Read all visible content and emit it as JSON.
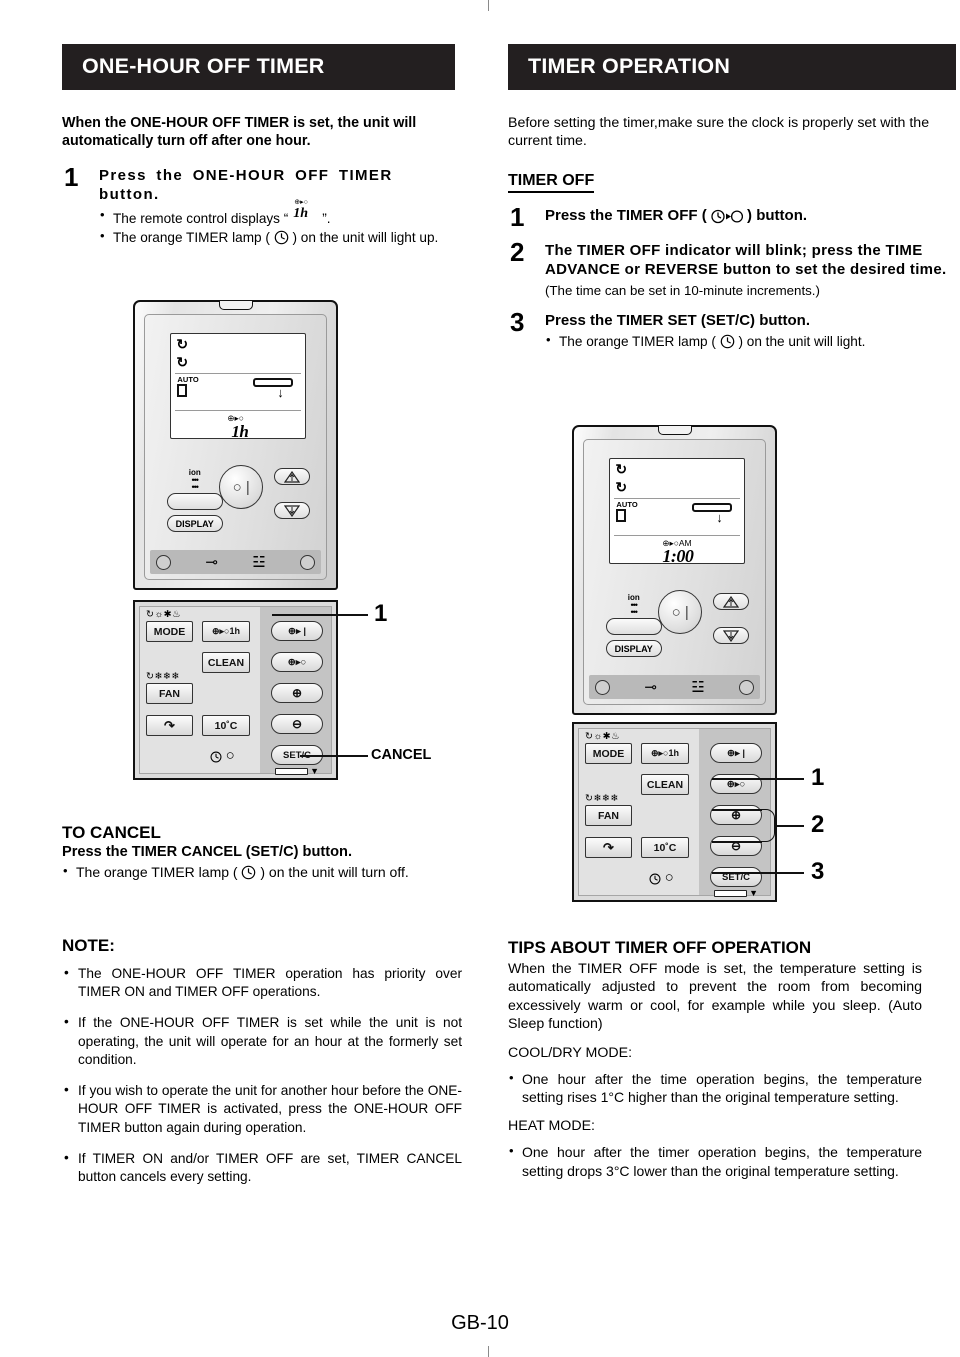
{
  "page": {
    "number": "GB-10"
  },
  "left": {
    "band_title": "ONE-HOUR OFF TIMER",
    "intro": "When the ONE-HOUR OFF TIMER is set, the unit will automatically turn off after one hour.",
    "step1": {
      "num": "1",
      "title": "Press the ONE-HOUR OFF TIMER button.",
      "bullet1_pre": "The remote control displays “",
      "bullet1_sym_top": "⊕▸○",
      "bullet1_sym_big": "1h",
      "bullet1_post": "”.",
      "bullet2_pre": "The orange TIMER lamp (",
      "bullet2_post": ") on the unit will light up."
    },
    "remote": {
      "lcd": {
        "auto": "AUTO",
        "timer_label": "⊕▸○",
        "value": "1h"
      },
      "buttons": {
        "ion": "ion",
        "display": "DISPLAY",
        "mode": "MODE",
        "one_hour": "⊕▸○1h",
        "clean": "CLEAN",
        "fan": "FAN",
        "ten_c": "10˚C",
        "timer_on": "⊕▸ |",
        "timer_off": "⊕▸○",
        "plus": "⊕",
        "minus": "⊖",
        "setc": "SET/C"
      }
    },
    "callouts": {
      "one": "1",
      "cancel": "CANCEL"
    },
    "cancel_section": {
      "heading": "TO CANCEL",
      "subheading": "Press the TIMER CANCEL (SET/C) button.",
      "bullet_pre": "The orange TIMER lamp (",
      "bullet_post": ") on the unit will turn off."
    },
    "note": {
      "heading": "NOTE:",
      "items": [
        "The ONE-HOUR OFF TIMER operation has priority over TIMER ON and TIMER OFF operations.",
        "If the ONE-HOUR OFF TIMER is set while the unit is not operating, the unit will operate for an hour at the formerly set condition.",
        "If you wish to operate the unit for another hour before the ONE-HOUR OFF TIMER is activated, press the ONE-HOUR OFF TIMER button again during operation.",
        "If TIMER ON and/or TIMER OFF are set, TIMER CANCEL button cancels every setting."
      ]
    }
  },
  "right": {
    "band_title": "TIMER OPERATION",
    "intro": "Before setting the timer,make sure the clock is properly set with the current time.",
    "subhead": "TIMER OFF",
    "step1": {
      "num": "1",
      "pre": "Press the TIMER OFF (",
      "post": ") button."
    },
    "step2": {
      "num": "2",
      "title": "The TIMER OFF indicator will blink; press the TIME ADVANCE or REVERSE button to set the desired time.",
      "paren": "(The time can be set in 10-minute increments.)"
    },
    "step3": {
      "num": "3",
      "title": "Press the TIMER SET (SET/C) button.",
      "bullet_pre": "The orange TIMER lamp (",
      "bullet_post": ") on the unit will light."
    },
    "remote": {
      "lcd": {
        "auto": "AUTO",
        "timer_label": "⊕▸○AM",
        "value": "1:00"
      },
      "buttons": {
        "ion": "ion",
        "display": "DISPLAY",
        "mode": "MODE",
        "one_hour": "⊕▸○1h",
        "clean": "CLEAN",
        "fan": "FAN",
        "ten_c": "10˚C",
        "timer_on": "⊕▸ |",
        "timer_off": "⊕▸○",
        "plus": "⊕",
        "minus": "⊖",
        "setc": "SET/C"
      }
    },
    "callouts": {
      "one": "1",
      "two": "2",
      "three": "3"
    },
    "tips": {
      "heading": "TIPS ABOUT TIMER OFF OPERATION",
      "body": "When the TIMER OFF mode is set, the temperature setting is automatically adjusted to prevent the room from becoming excessively warm or cool, for example while you sleep. (Auto Sleep function)",
      "cool_label": "COOL/DRY MODE:",
      "cool_bullet": "One hour after the time operation begins, the temperature setting rises 1°C higher than the original temperature setting.",
      "heat_label": "HEAT MODE:",
      "heat_bullet": "One hour after the timer operation begins, the temperature setting drops 3°C lower than the original temperature setting."
    }
  },
  "colors": {
    "band": "#231f20",
    "ink": "#000000",
    "panel": "#dcdcdc"
  }
}
